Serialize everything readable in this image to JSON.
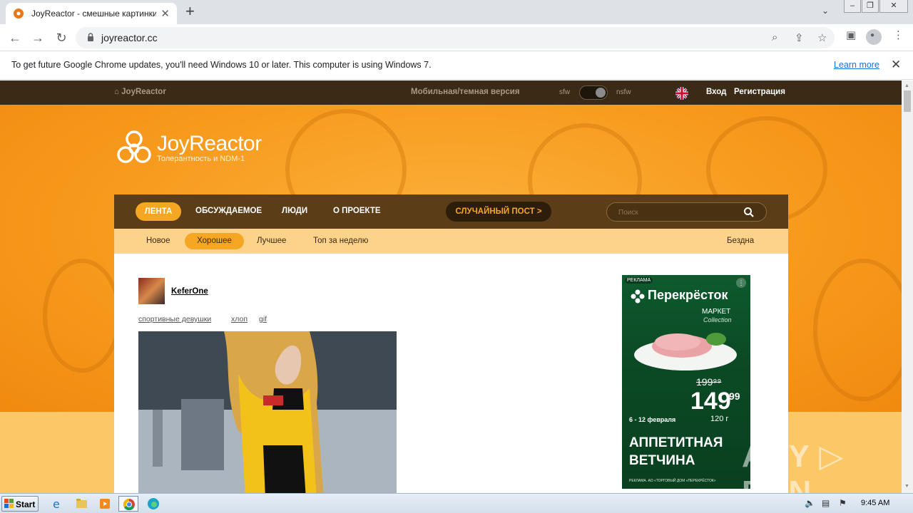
{
  "browser": {
    "tab_title": "JoyReactor - смешные картинки и",
    "tab_close": "✕",
    "new_tab": "+",
    "tab_search": "⌄",
    "window_controls": [
      "–",
      "❐",
      "✕"
    ],
    "url": "joyreactor.cc",
    "back": "←",
    "forward": "→",
    "reload": "↻",
    "zoom": "⌕",
    "share": "⇪",
    "bookmark": "☆",
    "sidepanel": "▣",
    "profile": "●",
    "menu": "⋮"
  },
  "infobar": {
    "message": "To get future Google Chrome updates, you'll need Windows 10 or later. This computer is using Windows 7.",
    "learn_more": "Learn more",
    "close": "✕"
  },
  "site": {
    "topnav": {
      "home": "JoyReactor",
      "mobile": "Мобильная/темная версия",
      "sfw": "sfw",
      "nsfw": "nsfw",
      "login": "Вход",
      "register": "Регистрация"
    },
    "logo": {
      "title": "JoyReactor",
      "subtitle": "Толерантность и NDM-1"
    },
    "mainnav": {
      "items": [
        "ЛЕНТА",
        "ОБСУЖДАЕМОЕ",
        "ЛЮДИ",
        "О ПРОЕКТЕ"
      ],
      "random": "СЛУЧАЙНЫЙ ПОСТ >",
      "search_placeholder": "Поиск"
    },
    "subnav": {
      "items": [
        "Новое",
        "Хорошее",
        "Лучшее",
        "Топ за неделю"
      ],
      "right": "Бездна"
    },
    "post": {
      "author": "KeferOne",
      "tags": [
        "спортивные девушки",
        "хлоп",
        "gif"
      ]
    },
    "ad": {
      "label": "РЕКЛАМА",
      "menu": "⋮",
      "brand": "Перекрёсток",
      "market": "МАРКЕТ",
      "collection": "Collection",
      "old_price": "199⁹⁹",
      "price": "149",
      "cents": "99",
      "weight": "120 г",
      "dates": "6 - 12 февраля",
      "title1": "АППЕТИТНАЯ",
      "title2": "ВЕТЧИНА",
      "small": "РЕКЛАМА. АО «ТОРГОВЫЙ ДОМ «ПЕРЕКРЁСТОК»"
    }
  },
  "watermark": "ANY ▷ RUN",
  "taskbar": {
    "start": "Start",
    "time": "9:45 AM"
  },
  "colors": {
    "orange": "#f79a1d",
    "dark_brown": "#3a2a16",
    "nav_brown": "#5b3d18",
    "accent": "#f5a623",
    "subnav": "#fdd28a"
  }
}
